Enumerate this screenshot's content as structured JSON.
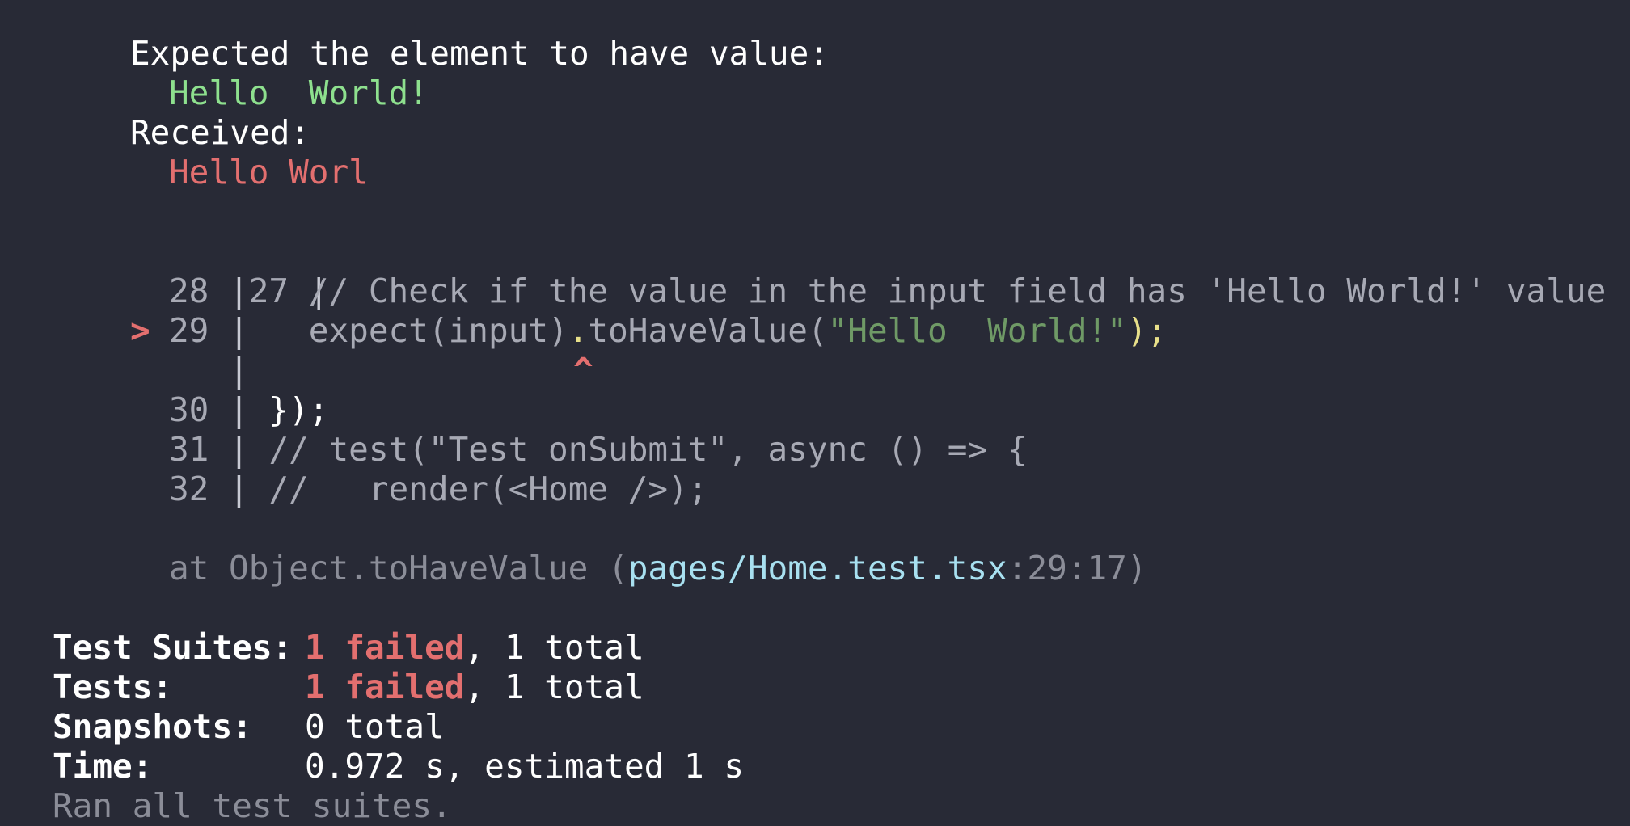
{
  "assertion": {
    "expected_label": "Expected the element to have value:",
    "expected_value": "Hello  World!",
    "received_label": "Received:",
    "received_value": "Hello Worl"
  },
  "code_frame": {
    "lines": [
      {
        "num": "27",
        "code": ""
      },
      {
        "num": "28",
        "code": "  // Check if the value in the input field has 'Hello World!' value"
      },
      {
        "num": "29",
        "marker": ">",
        "code_pre": "  expect(input)",
        "code_dot": ".",
        "code_call": "toHaveValue(",
        "code_str": "\"Hello  World!\"",
        "code_post": ");"
      },
      {
        "caret": "^"
      },
      {
        "num": "30",
        "code": "});"
      },
      {
        "num": "31",
        "code": "// test(\"Test onSubmit\", async () => {"
      },
      {
        "num": "32",
        "code": "//   render(<Home />);"
      }
    ],
    "pipe": "|"
  },
  "stack": {
    "prefix": "at Object.toHaveValue (",
    "file": "pages/Home.test.tsx",
    "location": ":29:17)"
  },
  "summary": {
    "suites_label": "Test Suites:",
    "suites_failed": "1 failed",
    "suites_total": ", 1 total",
    "tests_label": "Tests:",
    "tests_failed": "1 failed",
    "tests_total": ", 1 total",
    "snapshots_label": "Snapshots:",
    "snapshots_value": "0 total",
    "time_label": "Time:",
    "time_value": "0.972 s, estimated 1 s",
    "ran_text": "Ran all test suites."
  }
}
